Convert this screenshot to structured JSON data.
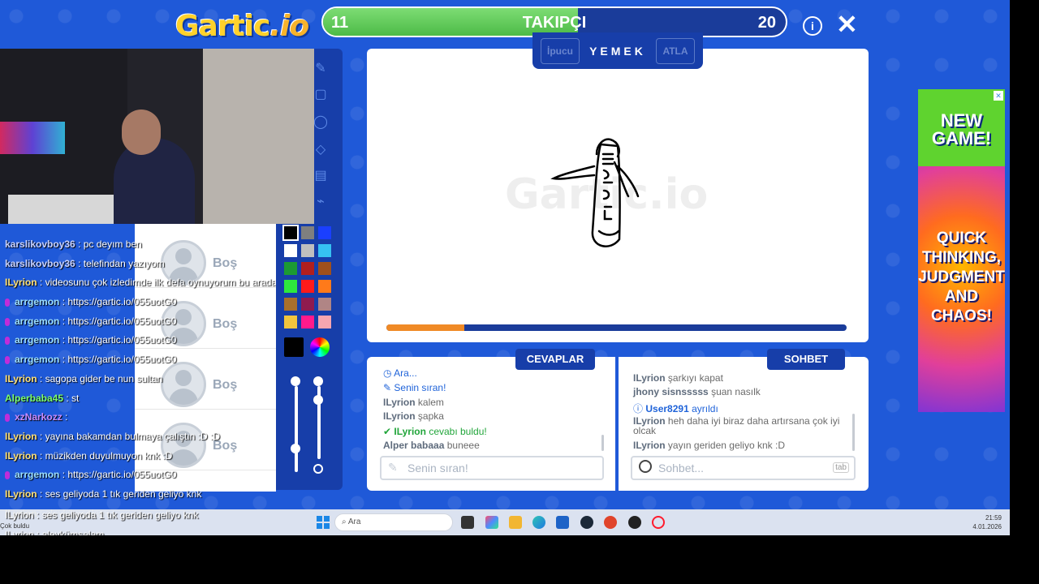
{
  "logo": {
    "text_main": "Gartic",
    "text_io": ".io"
  },
  "topbar": {
    "current": "11",
    "title": "TAKIPÇI",
    "total": "20",
    "progress_fraction": 0.55
  },
  "hint": {
    "hint_label": "İpucu",
    "word": "YEMEK",
    "skip_label": "ATLA"
  },
  "canvas": {
    "watermark": "Gartic.io",
    "timer_fraction": 0.17
  },
  "colors": {
    "accent_blue": "#1f59d8",
    "panel_blue": "#173ea9",
    "swatches": [
      "#000000",
      "#7f7f7f",
      "#1a3fff",
      "#ffffff",
      "#bfbfbf",
      "#36c2f2",
      "#1c9a33",
      "#b11f1f",
      "#a0501c",
      "#2ee83d",
      "#ff1a1a",
      "#ff7a1a",
      "#a86f2c",
      "#8f1b4f",
      "#b08585",
      "#f2c53d",
      "#ff1a8c",
      "#f7a6b0"
    ]
  },
  "players": [
    {
      "name": "Boş"
    },
    {
      "name": "Boş"
    },
    {
      "name": "Boş"
    },
    {
      "name": "Boş"
    }
  ],
  "stream_chat": [
    {
      "user": "karslikovboy36",
      "text": ": pc deyım ben"
    },
    {
      "user": "karslikovboy36",
      "text": ": telefindan yazıyom"
    },
    {
      "user": "ILyrion",
      "text": ": videosunu çok izledimde ilk defa oynuyorum bu arada :D"
    },
    {
      "user": "arrgemon",
      "text": ": https://gartic.io/055uotG0"
    },
    {
      "user": "arrgemon",
      "text": ": https://gartic.io/055uotG0"
    },
    {
      "user": "arrgemon",
      "text": ": https://gartic.io/055uotG0"
    },
    {
      "user": "arrgemon",
      "text": ": https://gartic.io/055uotG0"
    },
    {
      "user": "ILyrion",
      "text": ": sagopa gider be nun sultan"
    },
    {
      "user": "Alperbaba45",
      "text": ": st"
    },
    {
      "user": "xzNarkozz",
      "text": ":"
    },
    {
      "user": "ILyrion",
      "text": ": yayına bakamdan bulmaya çalıştın :D :D"
    },
    {
      "user": "ILyrion",
      "text": ": müzikden duyulmuyon knk :D"
    },
    {
      "user": "arrgemon",
      "text": ": https://gartic.io/055uotG0"
    },
    {
      "user": "ILyrion",
      "text": ": ses geliyoda 1 tık geriden geliyo knk"
    },
    {
      "user": "ILyrion",
      "text": ": aleykümselam"
    }
  ],
  "answers": {
    "tab_label": "CEVAPLAR",
    "messages": [
      {
        "user": "",
        "text": "Ara..."
      },
      {
        "user": "",
        "text": "Senin sıran!"
      },
      {
        "user": "ILyrion",
        "text": "kalem"
      },
      {
        "user": "ILyrion",
        "text": "şapka"
      },
      {
        "user": "ILyrion",
        "text": "cevabı buldu!"
      },
      {
        "user": "Alper babaaa",
        "text": "buneee"
      }
    ],
    "input_placeholder": "Senin sıran!"
  },
  "chat": {
    "tab_label": "SOHBET",
    "messages": [
      {
        "user": "ILyrion",
        "text": "şarkıyı kapat"
      },
      {
        "user": "jhony sisnsssss",
        "text": "şuan nasılk"
      },
      {
        "user": "User8291",
        "text": "ayrıldı"
      },
      {
        "user": "ILyrion",
        "text": "heh daha iyi biraz daha artırsana çok iyi olcak"
      },
      {
        "user": "ILyrion",
        "text": "yayın geriden geliyo knk :D"
      }
    ],
    "input_placeholder": "Sohbet...",
    "tab_hint": "tab"
  },
  "ad": {
    "line1": "NEW GAME!",
    "line2": "QUICK THINKING, JUDGMENT AND CHAOS!"
  },
  "overlay": {
    "line1": "ILyrion : ses geliyoda 1 tık geriden geliyo knk",
    "line2": "ILyrion : aleykümselam",
    "found": "Çok buldu"
  },
  "taskbar": {
    "search_placeholder": "Ara",
    "time": "21:59",
    "date": "4.01.2026"
  }
}
